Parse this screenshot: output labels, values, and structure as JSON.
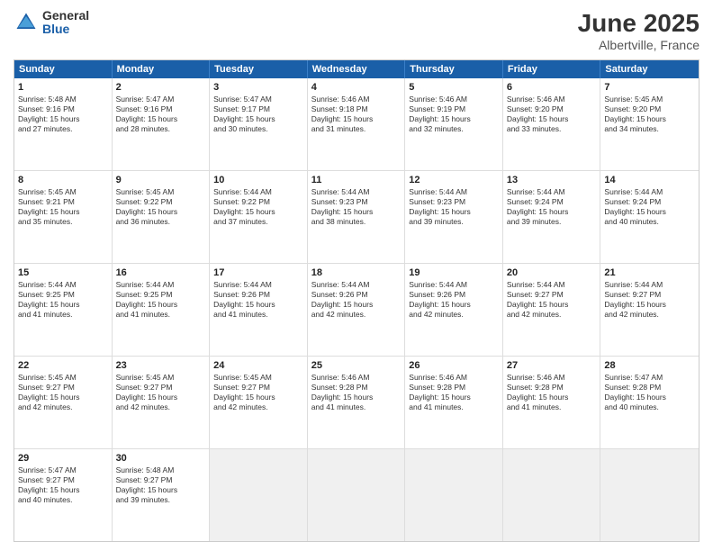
{
  "logo": {
    "general": "General",
    "blue": "Blue"
  },
  "title": "June 2025",
  "subtitle": "Albertville, France",
  "calendar": {
    "headers": [
      "Sunday",
      "Monday",
      "Tuesday",
      "Wednesday",
      "Thursday",
      "Friday",
      "Saturday"
    ],
    "rows": [
      [
        {
          "day": "1",
          "lines": [
            "Sunrise: 5:48 AM",
            "Sunset: 9:16 PM",
            "Daylight: 15 hours",
            "and 27 minutes."
          ]
        },
        {
          "day": "2",
          "lines": [
            "Sunrise: 5:47 AM",
            "Sunset: 9:16 PM",
            "Daylight: 15 hours",
            "and 28 minutes."
          ]
        },
        {
          "day": "3",
          "lines": [
            "Sunrise: 5:47 AM",
            "Sunset: 9:17 PM",
            "Daylight: 15 hours",
            "and 30 minutes."
          ]
        },
        {
          "day": "4",
          "lines": [
            "Sunrise: 5:46 AM",
            "Sunset: 9:18 PM",
            "Daylight: 15 hours",
            "and 31 minutes."
          ]
        },
        {
          "day": "5",
          "lines": [
            "Sunrise: 5:46 AM",
            "Sunset: 9:19 PM",
            "Daylight: 15 hours",
            "and 32 minutes."
          ]
        },
        {
          "day": "6",
          "lines": [
            "Sunrise: 5:46 AM",
            "Sunset: 9:20 PM",
            "Daylight: 15 hours",
            "and 33 minutes."
          ]
        },
        {
          "day": "7",
          "lines": [
            "Sunrise: 5:45 AM",
            "Sunset: 9:20 PM",
            "Daylight: 15 hours",
            "and 34 minutes."
          ]
        }
      ],
      [
        {
          "day": "8",
          "lines": [
            "Sunrise: 5:45 AM",
            "Sunset: 9:21 PM",
            "Daylight: 15 hours",
            "and 35 minutes."
          ]
        },
        {
          "day": "9",
          "lines": [
            "Sunrise: 5:45 AM",
            "Sunset: 9:22 PM",
            "Daylight: 15 hours",
            "and 36 minutes."
          ]
        },
        {
          "day": "10",
          "lines": [
            "Sunrise: 5:44 AM",
            "Sunset: 9:22 PM",
            "Daylight: 15 hours",
            "and 37 minutes."
          ]
        },
        {
          "day": "11",
          "lines": [
            "Sunrise: 5:44 AM",
            "Sunset: 9:23 PM",
            "Daylight: 15 hours",
            "and 38 minutes."
          ]
        },
        {
          "day": "12",
          "lines": [
            "Sunrise: 5:44 AM",
            "Sunset: 9:23 PM",
            "Daylight: 15 hours",
            "and 39 minutes."
          ]
        },
        {
          "day": "13",
          "lines": [
            "Sunrise: 5:44 AM",
            "Sunset: 9:24 PM",
            "Daylight: 15 hours",
            "and 39 minutes."
          ]
        },
        {
          "day": "14",
          "lines": [
            "Sunrise: 5:44 AM",
            "Sunset: 9:24 PM",
            "Daylight: 15 hours",
            "and 40 minutes."
          ]
        }
      ],
      [
        {
          "day": "15",
          "lines": [
            "Sunrise: 5:44 AM",
            "Sunset: 9:25 PM",
            "Daylight: 15 hours",
            "and 41 minutes."
          ]
        },
        {
          "day": "16",
          "lines": [
            "Sunrise: 5:44 AM",
            "Sunset: 9:25 PM",
            "Daylight: 15 hours",
            "and 41 minutes."
          ]
        },
        {
          "day": "17",
          "lines": [
            "Sunrise: 5:44 AM",
            "Sunset: 9:26 PM",
            "Daylight: 15 hours",
            "and 41 minutes."
          ]
        },
        {
          "day": "18",
          "lines": [
            "Sunrise: 5:44 AM",
            "Sunset: 9:26 PM",
            "Daylight: 15 hours",
            "and 42 minutes."
          ]
        },
        {
          "day": "19",
          "lines": [
            "Sunrise: 5:44 AM",
            "Sunset: 9:26 PM",
            "Daylight: 15 hours",
            "and 42 minutes."
          ]
        },
        {
          "day": "20",
          "lines": [
            "Sunrise: 5:44 AM",
            "Sunset: 9:27 PM",
            "Daylight: 15 hours",
            "and 42 minutes."
          ]
        },
        {
          "day": "21",
          "lines": [
            "Sunrise: 5:44 AM",
            "Sunset: 9:27 PM",
            "Daylight: 15 hours",
            "and 42 minutes."
          ]
        }
      ],
      [
        {
          "day": "22",
          "lines": [
            "Sunrise: 5:45 AM",
            "Sunset: 9:27 PM",
            "Daylight: 15 hours",
            "and 42 minutes."
          ]
        },
        {
          "day": "23",
          "lines": [
            "Sunrise: 5:45 AM",
            "Sunset: 9:27 PM",
            "Daylight: 15 hours",
            "and 42 minutes."
          ]
        },
        {
          "day": "24",
          "lines": [
            "Sunrise: 5:45 AM",
            "Sunset: 9:27 PM",
            "Daylight: 15 hours",
            "and 42 minutes."
          ]
        },
        {
          "day": "25",
          "lines": [
            "Sunrise: 5:46 AM",
            "Sunset: 9:28 PM",
            "Daylight: 15 hours",
            "and 41 minutes."
          ]
        },
        {
          "day": "26",
          "lines": [
            "Sunrise: 5:46 AM",
            "Sunset: 9:28 PM",
            "Daylight: 15 hours",
            "and 41 minutes."
          ]
        },
        {
          "day": "27",
          "lines": [
            "Sunrise: 5:46 AM",
            "Sunset: 9:28 PM",
            "Daylight: 15 hours",
            "and 41 minutes."
          ]
        },
        {
          "day": "28",
          "lines": [
            "Sunrise: 5:47 AM",
            "Sunset: 9:28 PM",
            "Daylight: 15 hours",
            "and 40 minutes."
          ]
        }
      ],
      [
        {
          "day": "29",
          "lines": [
            "Sunrise: 5:47 AM",
            "Sunset: 9:27 PM",
            "Daylight: 15 hours",
            "and 40 minutes."
          ]
        },
        {
          "day": "30",
          "lines": [
            "Sunrise: 5:48 AM",
            "Sunset: 9:27 PM",
            "Daylight: 15 hours",
            "and 39 minutes."
          ]
        },
        {
          "day": "",
          "lines": []
        },
        {
          "day": "",
          "lines": []
        },
        {
          "day": "",
          "lines": []
        },
        {
          "day": "",
          "lines": []
        },
        {
          "day": "",
          "lines": []
        }
      ]
    ]
  }
}
